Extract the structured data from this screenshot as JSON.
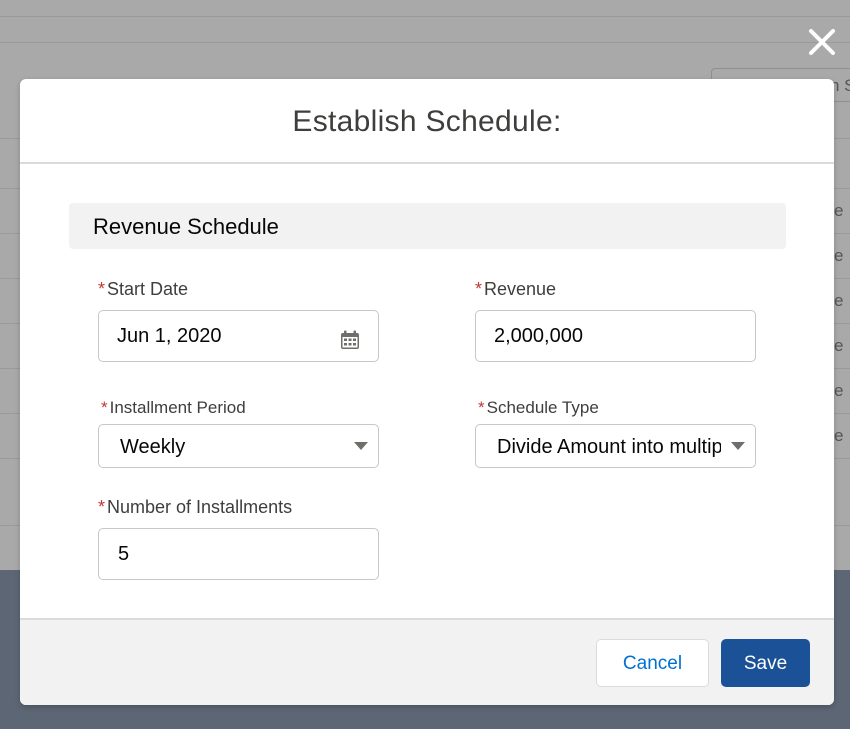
{
  "background": {
    "search_fragment": "n S",
    "row_fragments": [
      "e",
      "e",
      "e",
      "e",
      "e",
      "e"
    ]
  },
  "modal": {
    "title": "Establish Schedule:",
    "section_title": "Revenue Schedule",
    "fields": {
      "start_date": {
        "label": "Start Date",
        "required_mark": "*",
        "value": "Jun 1, 2020",
        "icon": "calendar-icon"
      },
      "revenue": {
        "label": "Revenue",
        "required_mark": "*",
        "value": "2,000,000"
      },
      "installment_period": {
        "label": "Installment Period",
        "required_mark": "*",
        "value": "Weekly"
      },
      "schedule_type": {
        "label": "Schedule Type",
        "required_mark": "*",
        "value": "Divide Amount into multiple installments"
      },
      "number_of_installments": {
        "label": "Number of Installments",
        "required_mark": "*",
        "value": "5"
      }
    },
    "footer": {
      "cancel_label": "Cancel",
      "save_label": "Save"
    }
  },
  "colors": {
    "brand_button": "#1b5297",
    "required_asterisk": "#c23934",
    "link_blue": "#0070d2"
  }
}
